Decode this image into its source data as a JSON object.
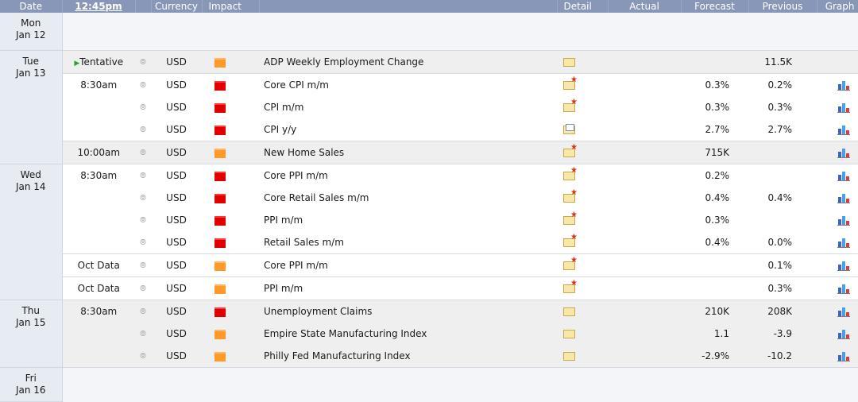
{
  "header": {
    "date": "Date",
    "time": "12:45pm",
    "currency": "Currency",
    "impact": "Impact",
    "detail": "Detail",
    "actual": "Actual",
    "forecast": "Forecast",
    "previous": "Previous",
    "graph": "Graph"
  },
  "colors": {
    "header_bg": "#8896b8",
    "high_impact": "#e00000",
    "medium_impact": "#ff9a2a",
    "row_gray": "#efefef"
  },
  "days": {
    "mon": {
      "weekday": "Mon",
      "date": "Jan 12"
    },
    "tue": {
      "weekday": "Tue",
      "date": "Jan 13"
    },
    "wed": {
      "weekday": "Wed",
      "date": "Jan 14"
    },
    "thu": {
      "weekday": "Thu",
      "date": "Jan 15"
    },
    "fri": {
      "weekday": "Fri",
      "date": "Jan 16"
    }
  },
  "events": [
    {
      "time": "Tentative",
      "currency": "USD",
      "impact": "medium",
      "name": "ADP Weekly Employment Change",
      "detail_icon": "folder-icon",
      "actual": "",
      "forecast": "",
      "previous": "11.5K",
      "graph": false
    },
    {
      "time": "8:30am",
      "currency": "USD",
      "impact": "high",
      "name": "Core CPI m/m",
      "detail_icon": "folder-new-icon",
      "actual": "",
      "forecast": "0.3%",
      "previous": "0.2%",
      "graph": true
    },
    {
      "time": "",
      "currency": "USD",
      "impact": "high",
      "name": "CPI m/m",
      "detail_icon": "folder-new-icon",
      "actual": "",
      "forecast": "0.3%",
      "previous": "0.3%",
      "graph": true
    },
    {
      "time": "",
      "currency": "USD",
      "impact": "high",
      "name": "CPI y/y",
      "detail_icon": "folder-doc-icon",
      "actual": "",
      "forecast": "2.7%",
      "previous": "2.7%",
      "graph": true
    },
    {
      "time": "10:00am",
      "currency": "USD",
      "impact": "medium",
      "name": "New Home Sales",
      "detail_icon": "folder-new-icon",
      "actual": "",
      "forecast": "715K",
      "previous": "",
      "graph": true
    },
    {
      "time": "8:30am",
      "currency": "USD",
      "impact": "high",
      "name": "Core PPI m/m",
      "detail_icon": "folder-new-icon",
      "actual": "",
      "forecast": "0.2%",
      "previous": "",
      "graph": true
    },
    {
      "time": "",
      "currency": "USD",
      "impact": "high",
      "name": "Core Retail Sales m/m",
      "detail_icon": "folder-new-icon",
      "actual": "",
      "forecast": "0.4%",
      "previous": "0.4%",
      "graph": true
    },
    {
      "time": "",
      "currency": "USD",
      "impact": "high",
      "name": "PPI m/m",
      "detail_icon": "folder-new-icon",
      "actual": "",
      "forecast": "0.3%",
      "previous": "",
      "graph": true
    },
    {
      "time": "",
      "currency": "USD",
      "impact": "high",
      "name": "Retail Sales m/m",
      "detail_icon": "folder-new-icon",
      "actual": "",
      "forecast": "0.4%",
      "previous": "0.0%",
      "graph": true
    },
    {
      "time": "Oct Data",
      "currency": "USD",
      "impact": "medium",
      "name": "Core PPI m/m",
      "detail_icon": "folder-new-icon",
      "actual": "",
      "forecast": "",
      "previous": "0.1%",
      "graph": true
    },
    {
      "time": "Oct Data",
      "currency": "USD",
      "impact": "medium",
      "name": "PPI m/m",
      "detail_icon": "folder-new-icon",
      "actual": "",
      "forecast": "",
      "previous": "0.3%",
      "graph": true
    },
    {
      "time": "8:30am",
      "currency": "USD",
      "impact": "high",
      "name": "Unemployment Claims",
      "detail_icon": "folder-icon",
      "actual": "",
      "forecast": "210K",
      "previous": "208K",
      "graph": true
    },
    {
      "time": "",
      "currency": "USD",
      "impact": "medium",
      "name": "Empire State Manufacturing Index",
      "detail_icon": "folder-icon",
      "actual": "",
      "forecast": "1.1",
      "previous": "-3.9",
      "graph": true
    },
    {
      "time": "",
      "currency": "USD",
      "impact": "medium",
      "name": "Philly Fed Manufacturing Index",
      "detail_icon": "folder-icon",
      "actual": "",
      "forecast": "-2.9%",
      "previous": "-10.2",
      "graph": true
    }
  ]
}
